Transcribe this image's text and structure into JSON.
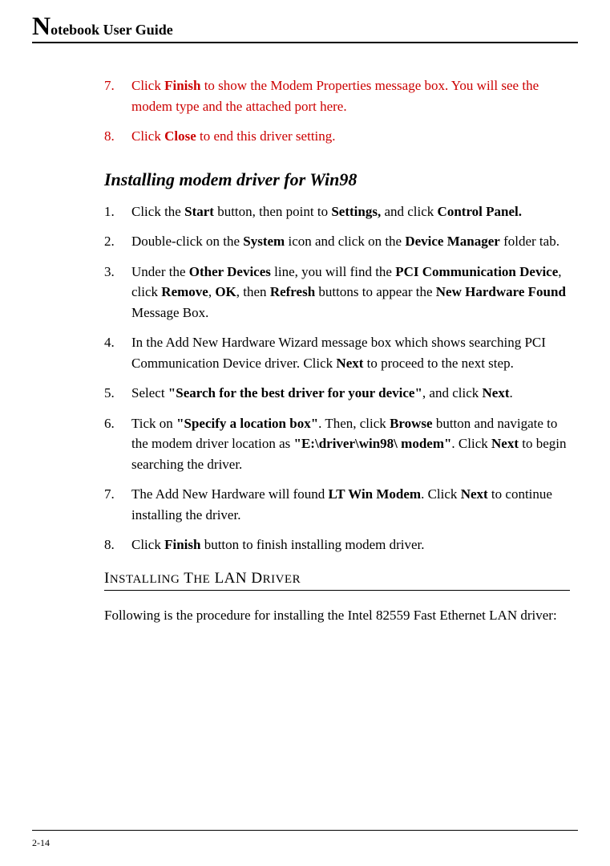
{
  "header": {
    "dropcap": "N",
    "title_rest": "otebook User Guide"
  },
  "red_items": {
    "item7": {
      "num": "7.",
      "pre": "Click ",
      "bold": "Finish",
      "post": " to show the Modem Properties message box. You will see the modem type and the attached port here."
    },
    "item8": {
      "num": "8.",
      "pre": "Click ",
      "bold": "Close",
      "post": " to end this driver setting."
    }
  },
  "subheading1": "Installing modem driver for Win98",
  "win98": {
    "i1": {
      "num": "1.",
      "t1": "Click the ",
      "b1": "Start",
      "t2": " button, then point to ",
      "b2": "Settings,",
      "t3": " and click ",
      "b3": "Control Panel."
    },
    "i2": {
      "num": "2.",
      "t1": "Double-click on the ",
      "b1": "System",
      "t2": " icon and click on the ",
      "b2": "Device Manager",
      "t3": " folder tab."
    },
    "i3": {
      "num": "3.",
      "t1": "Under the ",
      "b1": "Other Devices",
      "t2": " line, you will find the ",
      "b2": "PCI Communication Device",
      "t3": ", click ",
      "b3": "Remove",
      "t4": ", ",
      "b4": "OK",
      "t5": ", then ",
      "b5": "Refresh",
      "t6": " buttons to appear the ",
      "b6": "New Hardware Found",
      "t7": " Message Box."
    },
    "i4": {
      "num": "4.",
      "t1": "In the Add New Hardware Wizard message box which shows searching PCI Communication Device driver. Click ",
      "b1": "Next",
      "t2": " to proceed to the next step."
    },
    "i5": {
      "num": "5.",
      "t1": "Select ",
      "b1": "\"Search for the best driver for your device\"",
      "t2": ", and click ",
      "b2": "Next",
      "t3": "."
    },
    "i6": {
      "num": "6.",
      "t1": "Tick on ",
      "b1": "\"Specify a location box\"",
      "t2": ". Then, click ",
      "b2": "Browse",
      "t3": " button and navigate to the modem driver location as ",
      "b3": "\"E:\\driver\\win98\\ modem\"",
      "t4": ". Click ",
      "b4": "Next",
      "t5": " to begin searching the driver."
    },
    "i7": {
      "num": "7.",
      "t1": "The Add New Hardware will found ",
      "b1": "LT Win Modem",
      "t2": ". Click ",
      "b2": "Next",
      "t3": " to continue installing the driver."
    },
    "i8": {
      "num": "8.",
      "t1": "Click ",
      "b1": "Finish",
      "t2": " button to finish installing modem driver."
    }
  },
  "section_heading": {
    "w1f": "I",
    "w1r": "NSTALLING",
    "w2f": " T",
    "w2r": "HE",
    "w3f": " LAN D",
    "w3r": "RIVER"
  },
  "lan_para": "Following is the procedure for installing the Intel 82559 Fast Ethernet LAN driver:",
  "footer": {
    "page": "2-14"
  }
}
